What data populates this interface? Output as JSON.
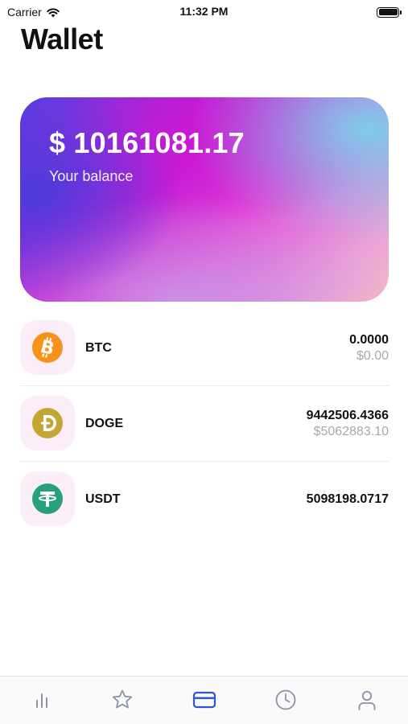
{
  "status_bar": {
    "carrier": "Carrier",
    "time": "11:32 PM"
  },
  "page": {
    "title": "Wallet"
  },
  "balance_card": {
    "amount": "$ 10161081.17",
    "label": "Your balance"
  },
  "coins": [
    {
      "symbol": "BTC",
      "amount": "0.0000",
      "value": "$0.00",
      "icon": "bitcoin-icon",
      "color": "#f7931a"
    },
    {
      "symbol": "DOGE",
      "amount": "9442506.4366",
      "value": "$5062883.10",
      "icon": "dogecoin-icon",
      "color": "#c3a634"
    },
    {
      "symbol": "USDT",
      "amount": "5098198.0717",
      "value": "",
      "icon": "tether-icon",
      "color": "#26a17b"
    }
  ],
  "tab_bar": {
    "tabs": [
      {
        "name": "markets",
        "icon": "bar-chart-icon"
      },
      {
        "name": "favorites",
        "icon": "star-icon"
      },
      {
        "name": "wallet",
        "icon": "card-icon",
        "active": true
      },
      {
        "name": "history",
        "icon": "clock-icon"
      },
      {
        "name": "profile",
        "icon": "person-icon"
      }
    ],
    "active_color": "#2f55d4",
    "inactive_color": "#8e93a6"
  }
}
